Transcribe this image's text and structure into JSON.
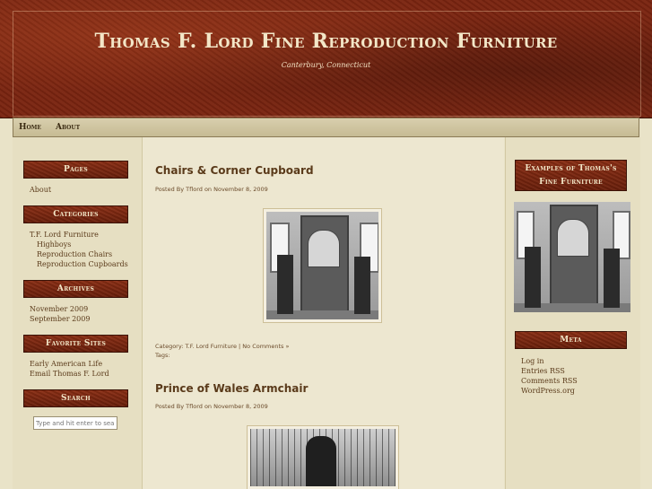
{
  "site": {
    "title": "Thomas F. Lord Fine Reproduction Furniture",
    "tagline": "Canterbury, Connecticut"
  },
  "nav": {
    "items": [
      {
        "label": "Home"
      },
      {
        "label": "About"
      }
    ]
  },
  "left_sidebar": {
    "pages": {
      "title": "Pages",
      "links": [
        "About"
      ]
    },
    "categories": {
      "title": "Categories",
      "links": [
        "T.F. Lord Furniture",
        "Highboys",
        "Reproduction Chairs",
        "Reproduction Cupboards"
      ]
    },
    "archives": {
      "title": "Archives",
      "links": [
        "November 2009",
        "September 2009"
      ]
    },
    "favorite_sites": {
      "title": "Favorite Sites",
      "links": [
        "Early American Life",
        "Email Thomas F. Lord"
      ]
    },
    "search": {
      "title": "Search",
      "placeholder": "Type and hit enter to search"
    }
  },
  "posts": [
    {
      "title": "Chairs & Corner Cupboard",
      "meta": "Posted By Tflord on November 8, 2009",
      "category_line": "Category: T.F. Lord Furniture | No Comments »",
      "tags_line": "Tags:"
    },
    {
      "title": "Prince of Wales Armchair",
      "meta": "Posted By Tflord on November 8, 2009"
    }
  ],
  "right_sidebar": {
    "examples": {
      "title_line1": "Examples of Thomas's",
      "title_line2": "Fine Furniture"
    },
    "meta": {
      "title": "Meta",
      "links": [
        "Log in",
        "Entries RSS",
        "Comments RSS",
        "WordPress.org"
      ]
    }
  },
  "colors": {
    "header_bg": "#7a2410",
    "widget_title_bg": "#7a2410",
    "page_bg": "#e9e3c8",
    "text": "#5a3a1a"
  }
}
